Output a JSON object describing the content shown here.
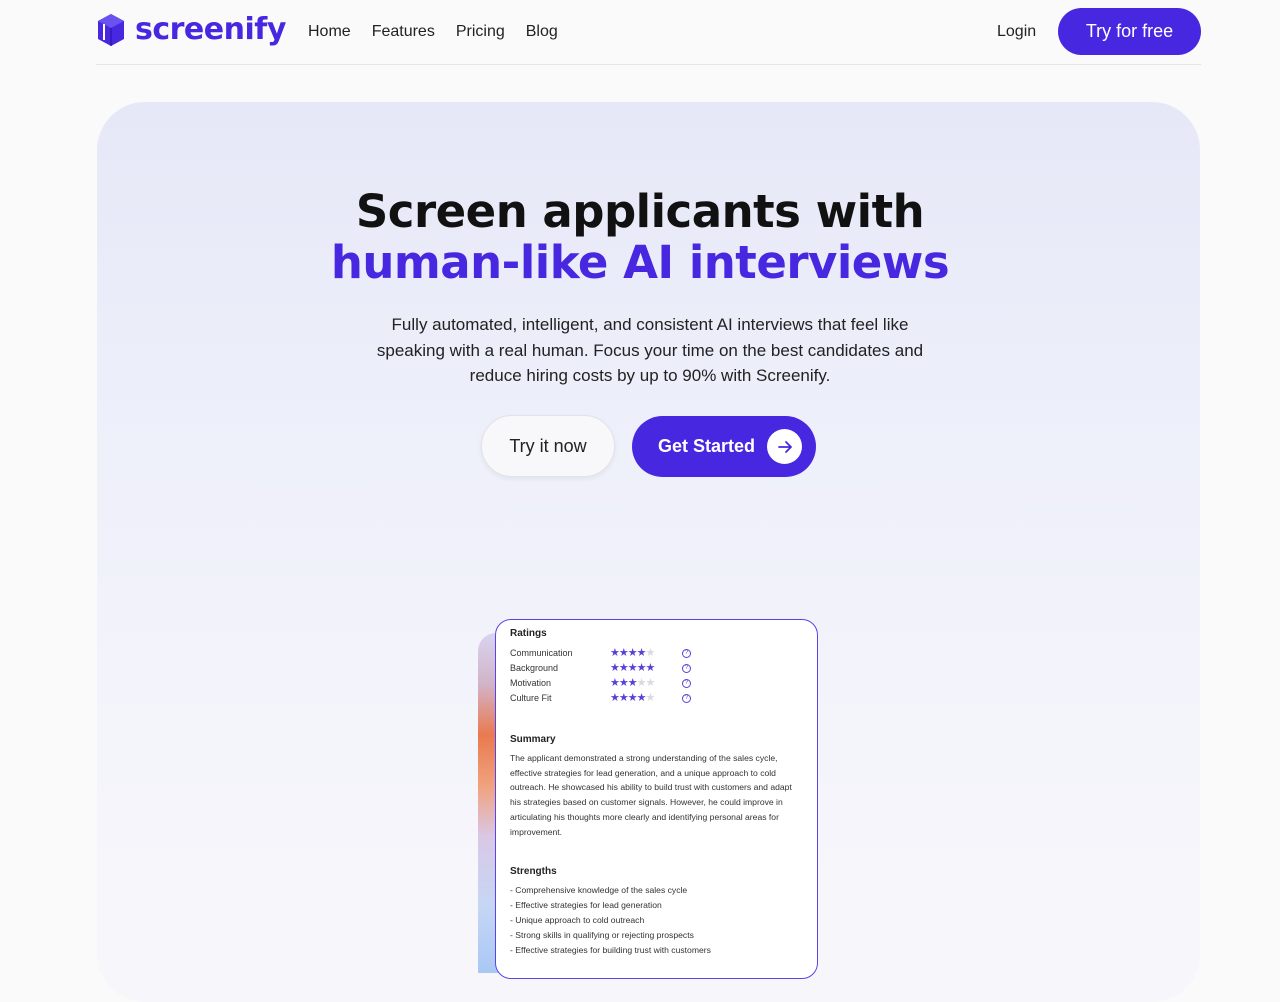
{
  "brand": {
    "name": "screenify",
    "color": "#4727e0"
  },
  "nav": {
    "links": [
      "Home",
      "Features",
      "Pricing",
      "Blog"
    ],
    "login": "Login",
    "cta": "Try for free"
  },
  "hero": {
    "headline_line1": "Screen applicants with",
    "headline_line2": "human-like AI interviews",
    "subtext": "Fully automated, intelligent, and consistent AI interviews that feel like speaking with a real human. Focus your time on the best candidates and reduce hiring costs by up to 90% with Screenify.",
    "try_label": "Try it now",
    "start_label": "Get Started",
    "start_icon": "arrow-right-icon"
  },
  "card": {
    "ratings_title": "Ratings",
    "ratings": [
      {
        "label": "Communication",
        "stars": 4,
        "max": 5
      },
      {
        "label": "Background",
        "stars": 5,
        "max": 5
      },
      {
        "label": "Motivation",
        "stars": 3,
        "max": 5
      },
      {
        "label": "Culture Fit",
        "stars": 4,
        "max": 5
      }
    ],
    "summary_title": "Summary",
    "summary_text": "The applicant demonstrated a strong understanding of the sales cycle, effective strategies for lead generation, and a unique approach to cold outreach. He showcased his ability to build trust with customers and adapt his strategies based on customer signals. However, he could improve in articulating his thoughts more clearly and identifying personal areas for improvement.",
    "strengths_title": "Strengths",
    "strengths": [
      "- Comprehensive knowledge of the sales cycle",
      "- Effective strategies for lead generation",
      "- Unique approach to cold outreach",
      "- Strong skills in qualifying or rejecting prospects",
      "- Effective strategies for building trust with customers"
    ]
  }
}
